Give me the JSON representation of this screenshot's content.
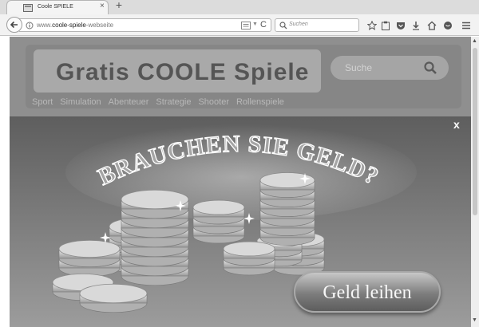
{
  "tab": {
    "title": "Coole SPIELE",
    "close": "×",
    "new_tab": "+"
  },
  "urlbar": {
    "url_prefix": "www.",
    "url_domain": "coole-spiele",
    "url_rest": "-webseite",
    "reload": "C"
  },
  "searchbar": {
    "placeholder": "Suchen"
  },
  "toolbar_icons": [
    "star-icon",
    "clipboard-icon",
    "pocket-icon",
    "download-icon",
    "home-icon",
    "chat-icon",
    "menu-icon"
  ],
  "site": {
    "logo": "Gratis COOLE Spiele",
    "search_placeholder": "Suche",
    "nav": [
      "Sport",
      "Simulation",
      "Abenteuer",
      "Strategie",
      "Shooter",
      "Rollenspiele"
    ]
  },
  "ad": {
    "close": "x",
    "headline": "BRAUCHEN SIE GELD?",
    "cta": "Geld leihen"
  },
  "colors": {
    "overlay_top": "#5e5e5e",
    "overlay_bottom": "#9c9c9c",
    "coin": "#d9d9d9"
  }
}
